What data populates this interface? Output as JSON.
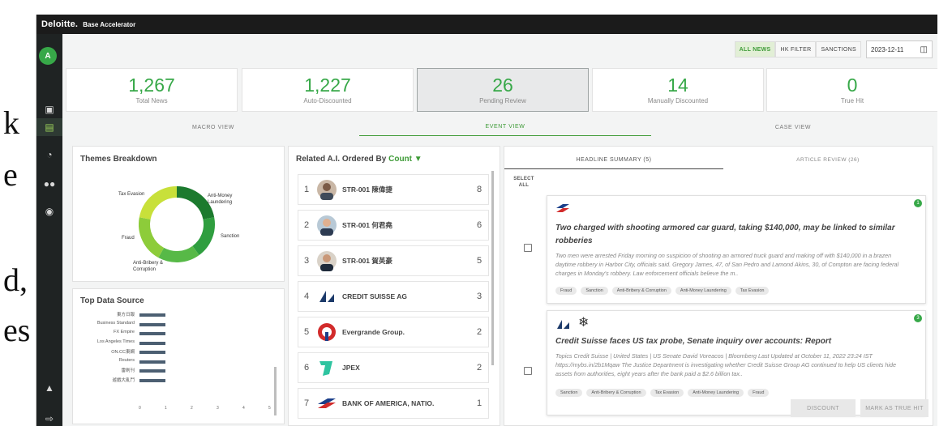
{
  "page_fragment": {
    "lines": [
      "k",
      "e",
      "d,",
      "es"
    ]
  },
  "app": {
    "brand": "Deloitte.",
    "name": "Base Accelerator",
    "avatar": "A"
  },
  "filters": {
    "buttons": [
      "ALL NEWS",
      "HK FILTER",
      "SANCTIONS"
    ],
    "active": "ALL NEWS",
    "date": "2023-12-11"
  },
  "stats": [
    {
      "value": "1,267",
      "label": "Total News"
    },
    {
      "value": "1,227",
      "label": "Auto-Discounted"
    },
    {
      "value": "26",
      "label": "Pending Review"
    },
    {
      "value": "14",
      "label": "Manually Discounted"
    },
    {
      "value": "0",
      "label": "True Hit"
    }
  ],
  "view_tabs": {
    "macro": "MACRO VIEW",
    "event": "EVENT VIEW",
    "case": "CASE VIEW",
    "active": "EVENT VIEW"
  },
  "themes": {
    "title": "Themes Breakdown",
    "labels": [
      "Tax Evasion",
      "Anti-Money Laundering",
      "Sanction",
      "Anti-Bribery & Corruption",
      "Fraud"
    ]
  },
  "data_source": {
    "title": "Top Data Source",
    "sources": [
      "東方日報",
      "Business Standard",
      "FX Empire",
      "Los Angeles Times",
      "ON.CC東網",
      "Reuters",
      "雷刷刊",
      "遊戲大亂鬥"
    ],
    "values": [
      1,
      1,
      1,
      1,
      1,
      1,
      1,
      1
    ],
    "ticks": [
      "0",
      "1",
      "2",
      "3",
      "4",
      "5"
    ]
  },
  "related": {
    "title_prefix": "Related A.I. Ordered By",
    "order_by": "Count",
    "items": [
      {
        "idx": "1",
        "name": "STR-001 陳偉捷",
        "count": "8",
        "logo": "person-photo-icon"
      },
      {
        "idx": "2",
        "name": "STR-001 何君堯",
        "count": "6",
        "logo": "person-photo-icon"
      },
      {
        "idx": "3",
        "name": "STR-001 賀英豪",
        "count": "5",
        "logo": "person-photo-icon"
      },
      {
        "idx": "4",
        "name": "CREDIT SUISSE AG",
        "count": "3",
        "logo": "sails-logo-icon"
      },
      {
        "idx": "5",
        "name": "Evergrande Group.",
        "count": "2",
        "logo": "evergrande-logo-icon"
      },
      {
        "idx": "6",
        "name": "JPEX",
        "count": "2",
        "logo": "jpex-logo-icon"
      },
      {
        "idx": "7",
        "name": "BANK OF AMERICA, NATIO.",
        "count": "1",
        "logo": "flag-logo-icon"
      }
    ]
  },
  "headline": {
    "tab_summary": "HEADLINE SUMMARY (5)",
    "tab_review": "ARTICLE REVIEW (26)",
    "select_all": "SELECT ALL",
    "cards": [
      {
        "badge": "1",
        "title": "Two charged with shooting armored car guard, taking $140,000, may be linked to similar robberies",
        "body": "Two men were arrested Friday morning on suspicion of shooting an armored truck guard and making off with $140,000 in a brazen daytime robbery in Harbor City, officials said. Gregory James, 47, of San Pedro and Lamond Akins, 30, of Compton are facing federal charges in Monday's robbery. Law enforcement officials believe the m..",
        "tags": [
          "Fraud",
          "Sanction",
          "Anti-Bribery & Corruption",
          "Anti-Money Laundering",
          "Tax Evasion"
        ]
      },
      {
        "badge": "3",
        "title": "Credit Suisse faces US tax probe, Senate inquiry over accounts: Report",
        "body": "Topics Credit Suisse | United States | US Senate David Voreacos | Bloomberg Last Updated at October 11, 2022 23:24 IST https://mybs.in/2b1Mqaw The Justice Department is investigating whether Credit Suisse Group AG continued to help US clients hide assets from authorities, eight years after the bank paid a $2.6 billion tax..",
        "tags": [
          "Sanction",
          "Anti-Bribery & Corruption",
          "Tax Evasion",
          "Anti-Money Laundering",
          "Fraud"
        ]
      }
    ],
    "discount": "DISCOUNT",
    "mark_true_hit": "MARK AS TRUE HIT"
  },
  "colors": {
    "accent": "#37a848",
    "dark": "#1b1b1b",
    "sidebar": "#1f2323",
    "donut": [
      "#1c7a2e",
      "#2f9e3f",
      "#57b947",
      "#8dcc3a",
      "#c8e03a"
    ]
  }
}
